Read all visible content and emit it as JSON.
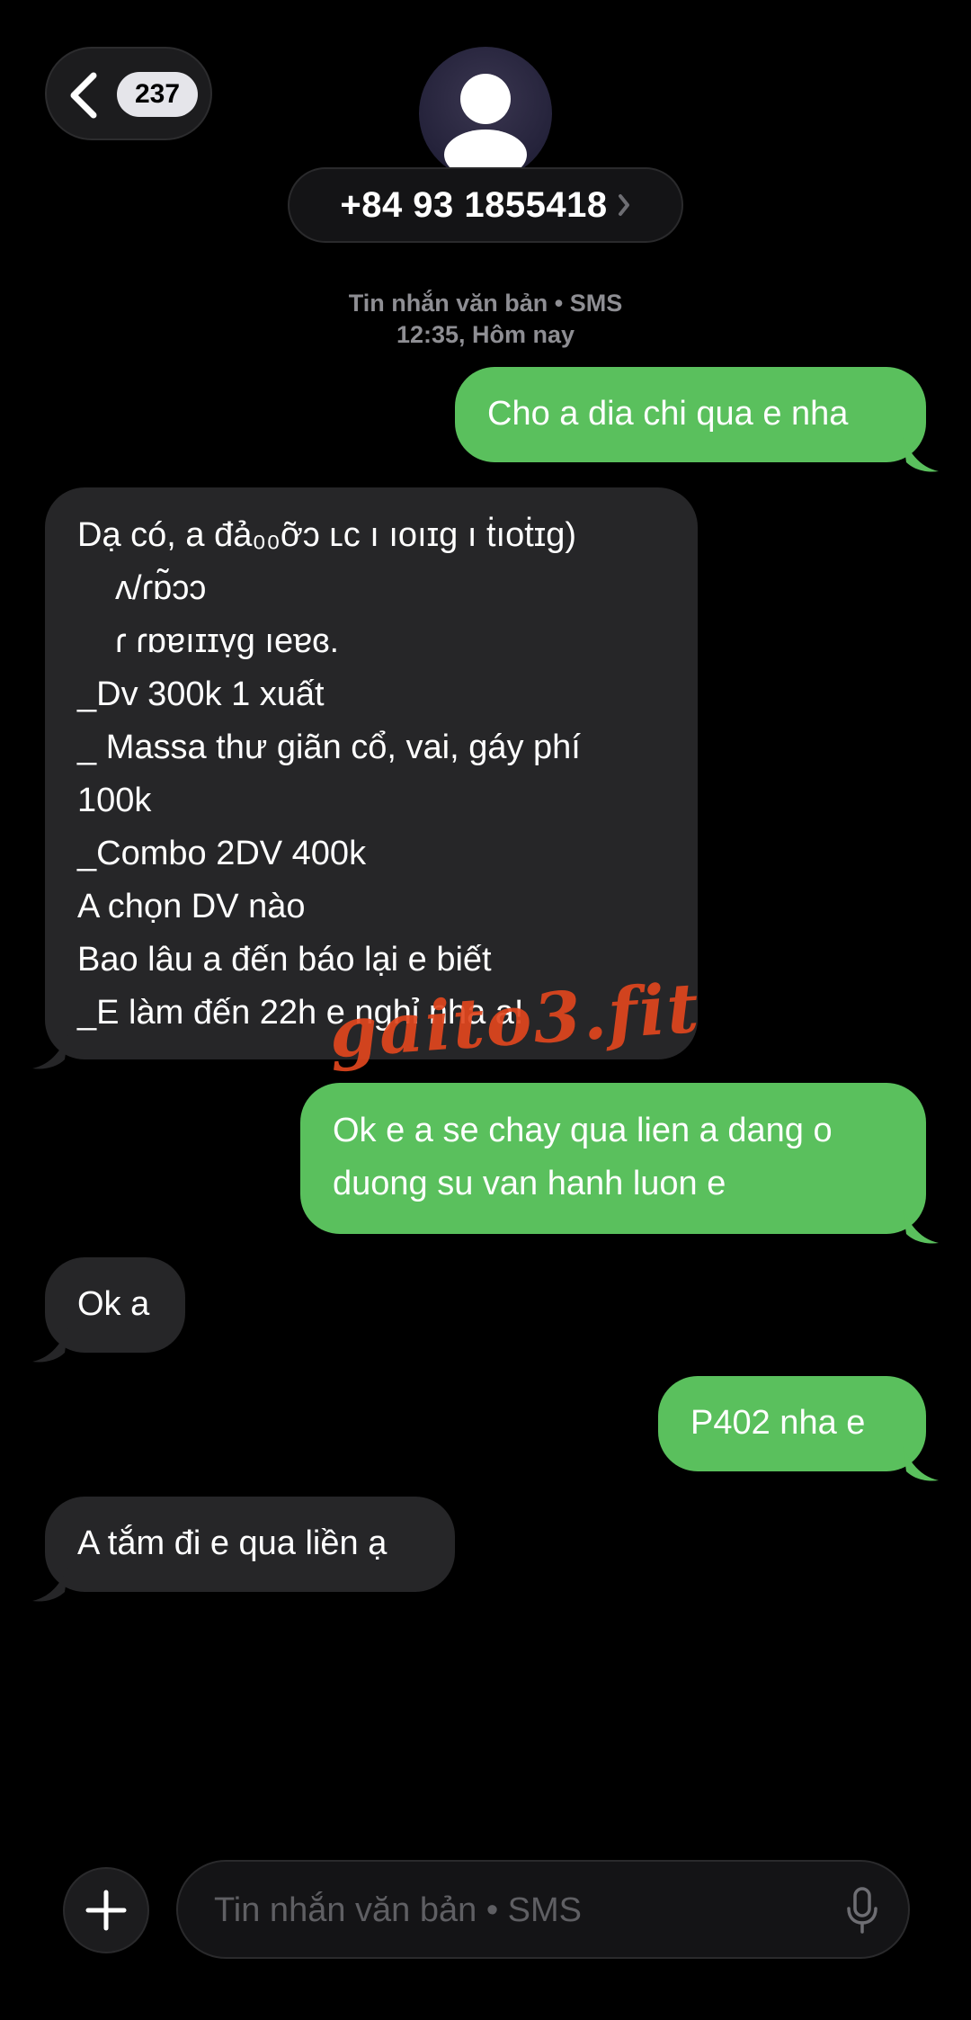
{
  "header": {
    "back_icon": "chevron-left-icon",
    "unread_count": "237",
    "avatar_icon": "person-silhouette-icon",
    "contact_name": "+84 93 1855418",
    "contact_chevron_icon": "chevron-right-icon"
  },
  "thread": {
    "service_label": "Tin nhắn văn bản • SMS",
    "timestamp": "12:35, Hôm nay"
  },
  "messages": [
    {
      "direction": "outgoing",
      "lines": [
        "Cho a dia chi qua e nha"
      ]
    },
    {
      "direction": "incoming",
      "lines": [
        "Dạ có, a đả₀₀ỡɔ ʟc ı ıoıɪg ı ṫıoṫɪg)",
        "ʌ/ɾɒ̃ɔɔ",
        "ɾ ɾɒɐıɪɪṿɡ ıeɐɞ.",
        "_Dv 300k 1 xuất",
        "_ Massa thư giãn cổ, vai, gáy phí",
        "100k",
        "_Combo 2DV 400k",
        "A chọn DV nào",
        "Bao lâu a đến báo lại e biết",
        "_E làm đến 22h e nghỉ nha a!"
      ]
    },
    {
      "direction": "outgoing",
      "lines": [
        "Ok e a se chay qua lien a dang o",
        "duong su van hanh luon e"
      ]
    },
    {
      "direction": "incoming",
      "lines": [
        "Ok a"
      ]
    },
    {
      "direction": "outgoing",
      "lines": [
        "P402 nha e"
      ]
    },
    {
      "direction": "incoming",
      "lines": [
        "A tắm đi e qua liền ạ"
      ]
    }
  ],
  "watermark": "gaito3.fit",
  "composer": {
    "placeholder": "Tin nhắn văn bản • SMS",
    "plus_icon": "plus-icon",
    "mic_icon": "microphone-icon"
  },
  "colors": {
    "outgoing_bubble": "#5ac05d",
    "incoming_bubble": "#262628",
    "background": "#000000",
    "watermark": "#e0461e"
  }
}
